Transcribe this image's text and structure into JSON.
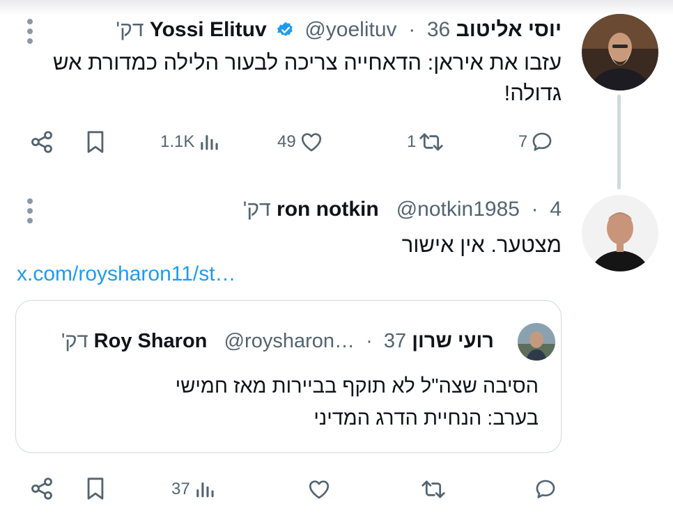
{
  "tweets": [
    {
      "name": "יוסי אליטוב Yossi Elituv",
      "handle": "@yoelituv",
      "time": "36 דק'",
      "verified": true,
      "text": "עזבו את איראן: הדאחייה צריכה לבעור הלילה כמדורת אש גדולה!",
      "replies": "7",
      "retweets": "1",
      "likes": "49",
      "views": "1.1K"
    },
    {
      "name": "ron notkin",
      "handle": "@notkin1985",
      "time": "4 דק'",
      "text": "מצטער. אין אישור",
      "link": "x.com/roysharon11/st…",
      "quote": {
        "name": "רועי שרון Roy Sharon",
        "handle": "@roysharon…",
        "time": "37 דק'",
        "text": "הסיבה שצה\"ל לא תוקף בביירות מאז חמישי בערב: הנחיית הדרג המדיני"
      },
      "views": "37"
    }
  ],
  "colors": {
    "text": "#0f1419",
    "muted": "#536471",
    "link": "#1d9bf0",
    "verified": "#1d9bf0",
    "thread_line": "#cfd9de"
  },
  "icons": [
    "more-dots-icon",
    "verified-badge-icon",
    "reply-icon",
    "retweet-icon",
    "like-icon",
    "views-icon",
    "bookmark-icon",
    "share-icon"
  ]
}
